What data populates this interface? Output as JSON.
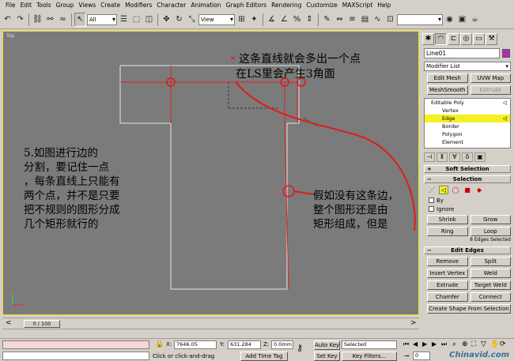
{
  "menu": [
    "File",
    "Edit",
    "Tools",
    "Group",
    "Views",
    "Create",
    "Modifiers",
    "Character",
    "Animation",
    "Graph Editors",
    "Rendering",
    "Customize",
    "MAXScript",
    "Help"
  ],
  "toolbar": {
    "filter_value": "All",
    "view_value": "View"
  },
  "viewport": {
    "label": "Top",
    "note_top_line1": "这条直线就会多出一个点",
    "note_top_line2": "在LS里会产生3角面",
    "note_left_line1": "5.如图进行边的",
    "note_left_line2": "分割，要记住一点",
    "note_left_line3": "，每条直线上只能有",
    "note_left_line4": "两个点，并不是只要",
    "note_left_line5": "把不规则的图形分成",
    "note_left_line6": "几个矩形就行的",
    "note_right_line1": "假如没有这条边，",
    "note_right_line2": "整个图形还是由",
    "note_right_line3": "矩形组成，但是",
    "annotation_color": "#e01b1b"
  },
  "panel": {
    "object_name": "Line01",
    "object_color": "#b52ab2",
    "modifier_list": "Modifier List",
    "buttons": {
      "edit_mesh": "Edit Mesh",
      "uvw_map": "UVW Map",
      "meshsmooth": "MeshSmooth",
      "extrude": "Extrude"
    },
    "stack": {
      "root": "Editable Poly",
      "items": [
        "Vertex",
        "Edge",
        "Border",
        "Polygon",
        "Element"
      ],
      "selected": "Edge"
    },
    "soft_selection": "Soft Selection",
    "selection": "Selection",
    "by_label": "By",
    "ignore_label": "Ignore",
    "shrink": "Shrink",
    "grow": "Grow",
    "ring": "Ring",
    "loop": "Loop",
    "edges_selected": "8 Edges Selected",
    "edit_edges": "Edit Edges",
    "remove": "Remove",
    "split": "Split",
    "insert_vertex": "Insert Vertex",
    "weld": "Weld",
    "extrude": "Extrude",
    "target_weld": "Target Weld",
    "chamfer": "Chamfer",
    "connect": "Connect",
    "create_shape": "Create Shape From Selection"
  },
  "time": {
    "slider": "0 / 100"
  },
  "status": {
    "x_label": "X:",
    "x_value": "7646.05",
    "y_label": "Y:",
    "y_value": "631.284",
    "z_label": "Z:",
    "z_value": "0.0mm",
    "auto_key": "Auto Key",
    "set_key": "Set Key",
    "selected_value": "Selected",
    "key_filters": "Key Filters...",
    "prompt": "Click or click-and-drag",
    "add_time_tag": "Add Time Tag",
    "frame": "0",
    "watermark": "Chinavid.com"
  }
}
